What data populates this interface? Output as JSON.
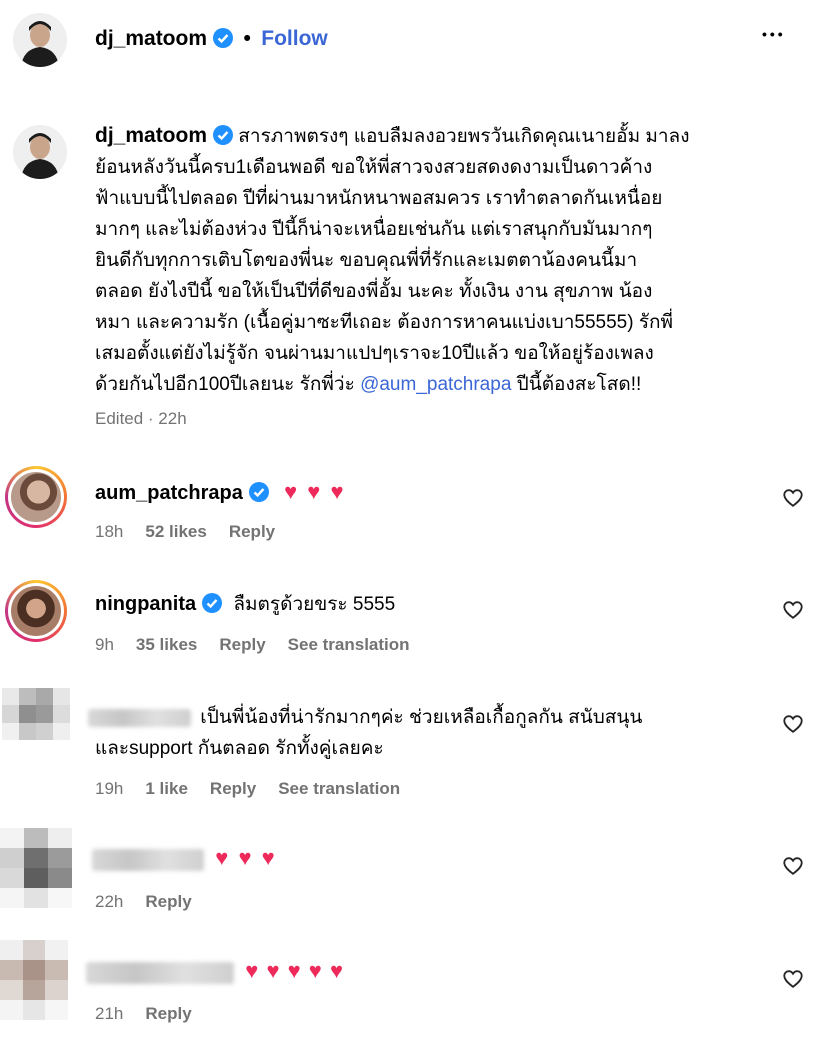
{
  "header": {
    "username": "dj_matoom",
    "separator": "•",
    "follow_label": "Follow",
    "more_label": "•••"
  },
  "post": {
    "username": "dj_matoom",
    "caption_lines": [
      "สารภาพตรงๆ แอบลืมลงอวยพรวันเกิดคุณเนายอั้ม มาลง",
      "ย้อนหลังวันนี้ครบ1เดือนพอดี ขอให้พี่สาวจงสวยสดงดงามเป็นดาวค้าง",
      "ฟ้าแบบนี้ไปตลอด ปีที่ผ่านมาหนักหนาพอสมควร เราทำตลาดกันเหนื่อย",
      "มากๆ และไม่ต้องห่วง ปีนี้ก็น่าจะเหนื่อยเช่นกัน แต่เราสนุกกับมันมากๆ",
      "ยินดีกับทุกการเติบโตของพี่นะ ขอบคุณพี่ที่รักและเมตตาน้องคนนี้มา",
      "ตลอด ยังไงปีนี้ ขอให้เป็นปีที่ดีของพี่อั้ม นะคะ ทั้งเงิน งาน สุขภาพ น้อง",
      "หมา และความรัก (เนื้อคู่มาซะทีเถอะ ต้องการหาคนแบ่งเบา55555) รักพี่",
      "เสมอตั้งแต่ยังไม่รู้จัก จนผ่านมาแปปๆเราจะ10ปีแล้ว ขอให้อยู่ร้องเพลง",
      "ด้วยกันไปอีก100ปีเลยนะ รักพี่ว่ะ"
    ],
    "mention": "@aum_patchrapa",
    "caption_tail": "ปีนี้ต้องสะโสด!!",
    "edited": "Edited · 22h"
  },
  "comments": [
    {
      "username": "aum_patchrapa",
      "text": "",
      "hearts": "♥ ♥ ♥",
      "time": "18h",
      "likes": "52 likes",
      "reply": "Reply",
      "translate": ""
    },
    {
      "username": "ningpanita",
      "text": "ลืมตรูด้วยขระ 5555",
      "hearts": "",
      "time": "9h",
      "likes": "35 likes",
      "reply": "Reply",
      "translate": "See translation"
    },
    {
      "username": "",
      "text_line1": "เป็นพี่น้องที่น่ารักมากๆค่ะ ช่วยเหลือเกื้อกูลกัน สนับสนุน",
      "text_line2": "และsupport กันตลอด รักทั้งคู่เลยคะ",
      "time": "19h",
      "likes": "1 like",
      "reply": "Reply",
      "translate": "See translation"
    },
    {
      "username": "",
      "hearts": "♥ ♥ ♥",
      "time": "22h",
      "reply": "Reply"
    },
    {
      "username": "",
      "hearts": "♥ ♥ ♥ ♥ ♥",
      "time": "21h",
      "reply": "Reply"
    }
  ],
  "colors": {
    "link": "#3b66d6",
    "verified": "#1e90ff",
    "heart": "#ee2a5a",
    "meta": "#737373"
  }
}
